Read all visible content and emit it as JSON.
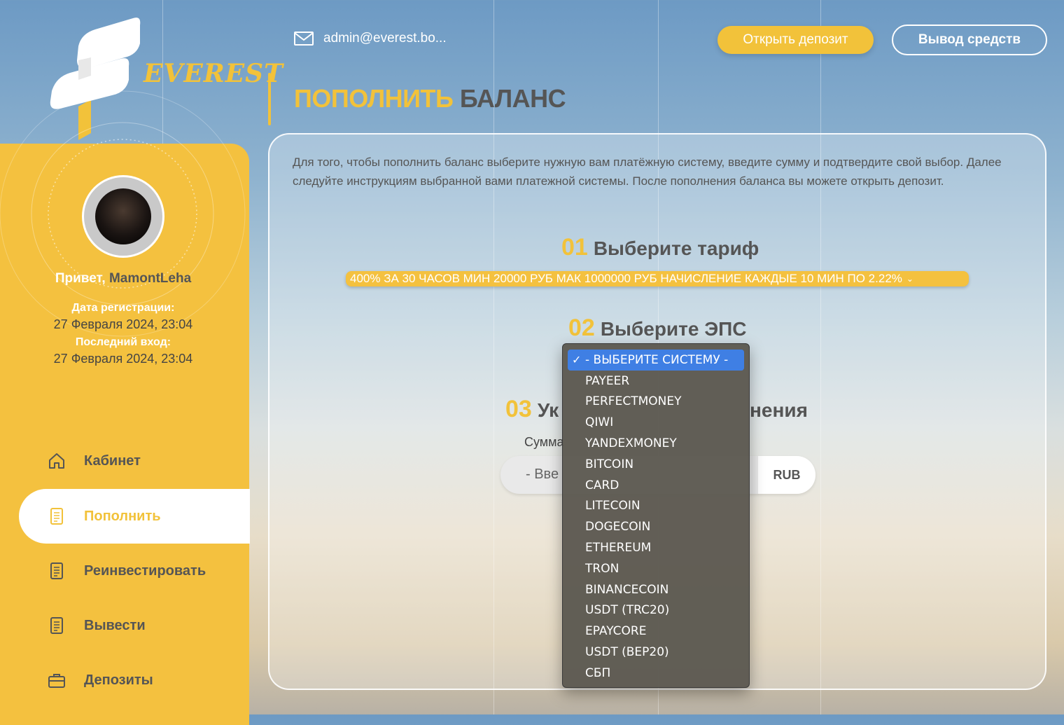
{
  "brand": {
    "name": "EVEREST"
  },
  "header": {
    "email": "admin@everest.bo...",
    "open_deposit": "Открыть депозит",
    "withdraw": "Вывод средств"
  },
  "page_title": {
    "highlight": "ПОПОЛНИТЬ",
    "rest": "БАЛАНС"
  },
  "profile": {
    "greeting": "Привет,",
    "username": "MamontLeha",
    "reg_label": "Дата регистрации:",
    "reg_value": "27 Февраля 2024, 23:04",
    "last_label": "Последний вход:",
    "last_value": "27 Февраля 2024, 23:04"
  },
  "nav": {
    "items": [
      {
        "label": "Кабинет",
        "icon": "home-icon"
      },
      {
        "label": "Пополнить",
        "icon": "document-icon"
      },
      {
        "label": "Реинвестировать",
        "icon": "document-icon"
      },
      {
        "label": "Вывести",
        "icon": "document-icon"
      },
      {
        "label": "Депозиты",
        "icon": "briefcase-icon"
      }
    ],
    "active": "Пополнить"
  },
  "main": {
    "description": "Для того, чтобы пополнить баланс выберите нужную вам платёжную систему, введите сумму и подтвердите свой выбор. Далее следуйте инструкциям выбранной вами платежной системы. После пополнения баланса вы можете открыть депозит.",
    "step1": {
      "num": "01",
      "label": "Выберите тариф"
    },
    "tariff_value": "400% ЗА 30 ЧАСОВ МИН 20000 РУБ МАК 1000000 РУБ НАЧИСЛЕНИЕ КАЖДЫЕ 10 МИН ПО 2.22%",
    "step2": {
      "num": "02",
      "label": "Выберите ЭПС"
    },
    "step3": {
      "num": "03",
      "label_start": "Ук",
      "label_end": "нения"
    },
    "sum_label": "Сумма",
    "amount_placeholder": "- Вве",
    "currency": "RUB"
  },
  "dropdown": {
    "options": [
      "- ВЫБЕРИТЕ СИСТЕМУ -",
      "PAYEER",
      "PERFECTMONEY",
      "QIWI",
      "YANDEXMONEY",
      "BITCOIN",
      "CARD",
      "LITECOIN",
      "DOGECOIN",
      "ETHEREUM",
      "TRON",
      "BINANCECOIN",
      "USDT (TRC20)",
      "EPAYCORE",
      "USDT (BEP20)",
      "СБП"
    ],
    "selected": "- ВЫБЕРИТЕ СИСТЕМУ -"
  },
  "colors": {
    "accent": "#f2c23a",
    "text": "#555555",
    "selection": "#3f7fe4"
  }
}
